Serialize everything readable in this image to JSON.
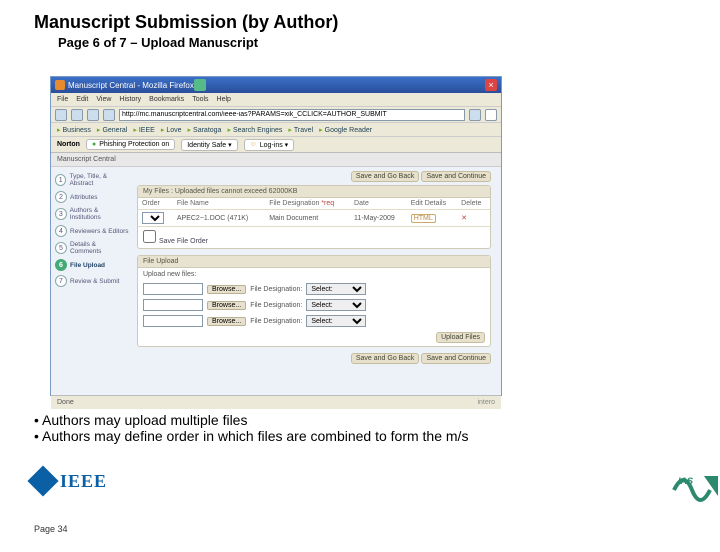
{
  "slide": {
    "title": "Manuscript Submission (by Author)",
    "subtitle": "Page 6 of 7 – Upload Manuscript",
    "page_label": "Page 34"
  },
  "window": {
    "title": "Manuscript Central - Mozilla Firefox",
    "menu": [
      "File",
      "Edit",
      "View",
      "History",
      "Bookmarks",
      "Tools",
      "Help"
    ],
    "url": "http://mc.manuscriptcentral.com/ieee-ias?PARAMS=xik_CCLICK=AUTHOR_SUBMIT",
    "bookmarks": [
      "Business",
      "General",
      "IEEE",
      "Love",
      "Saratoga",
      "Search Engines",
      "Travel",
      "Google Reader"
    ],
    "norton_label": "Norton",
    "norton_pill1": "Phishing Protection on",
    "norton_pill2": "Identity Safe ▾",
    "norton_pill3": "Log-ins ▾",
    "tab": "Manuscript Central",
    "status": "Done",
    "brand": "intero"
  },
  "steps": [
    {
      "n": "1",
      "label": "Type, Title, & Abstract"
    },
    {
      "n": "2",
      "label": "Attributes"
    },
    {
      "n": "3",
      "label": "Authors & Institutions"
    },
    {
      "n": "4",
      "label": "Reviewers & Editors"
    },
    {
      "n": "5",
      "label": "Details & Comments"
    },
    {
      "n": "6",
      "label": "File Upload"
    },
    {
      "n": "7",
      "label": "Review & Submit"
    }
  ],
  "buttons": {
    "save_back": "Save and Go Back",
    "save_cont": "Save and Continue",
    "upload": "Upload Files",
    "browse": "Browse..."
  },
  "files_panel": {
    "header": "My Files : Uploaded files cannot exceed 62000KB",
    "columns": [
      "Order",
      "File Name",
      "File Designation",
      "Date",
      "Edit Details",
      "Delete"
    ],
    "rows": [
      {
        "order": "1",
        "name": "APEC2~1.DOC (471K)",
        "desig": "Main Document",
        "date": "11-May-2009",
        "edit": "HTML",
        "del": "✕"
      }
    ],
    "save_order": "Save File Order"
  },
  "upload_panel": {
    "header": "File Upload",
    "sub": "Upload new files:",
    "desig_label": "File Designation:",
    "select_default": "Select:"
  },
  "bullets": [
    "Authors may upload multiple files",
    "Authors may define order in which files are combined to form the m/s"
  ],
  "logos": {
    "ieee": "IEEE",
    "ias": "IAS"
  }
}
